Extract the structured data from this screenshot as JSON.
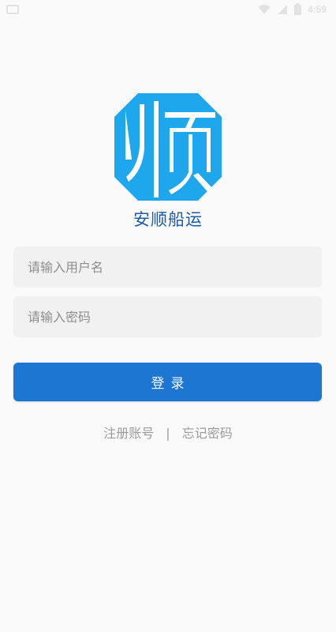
{
  "status_bar": {
    "time": "4:59"
  },
  "app": {
    "logo_char": "顺",
    "name": "安顺船运"
  },
  "login_form": {
    "username_placeholder": "请输入用户名",
    "password_placeholder": "请输入密码",
    "login_label": "登录"
  },
  "links": {
    "register_label": "注册账号",
    "separator": "|",
    "forgot_password_label": "忘记密码"
  },
  "colors": {
    "primary": "#1c76d2",
    "logo_blue": "#1ea7ec",
    "app_name": "#1a5aa8",
    "background": "#fafafa"
  }
}
